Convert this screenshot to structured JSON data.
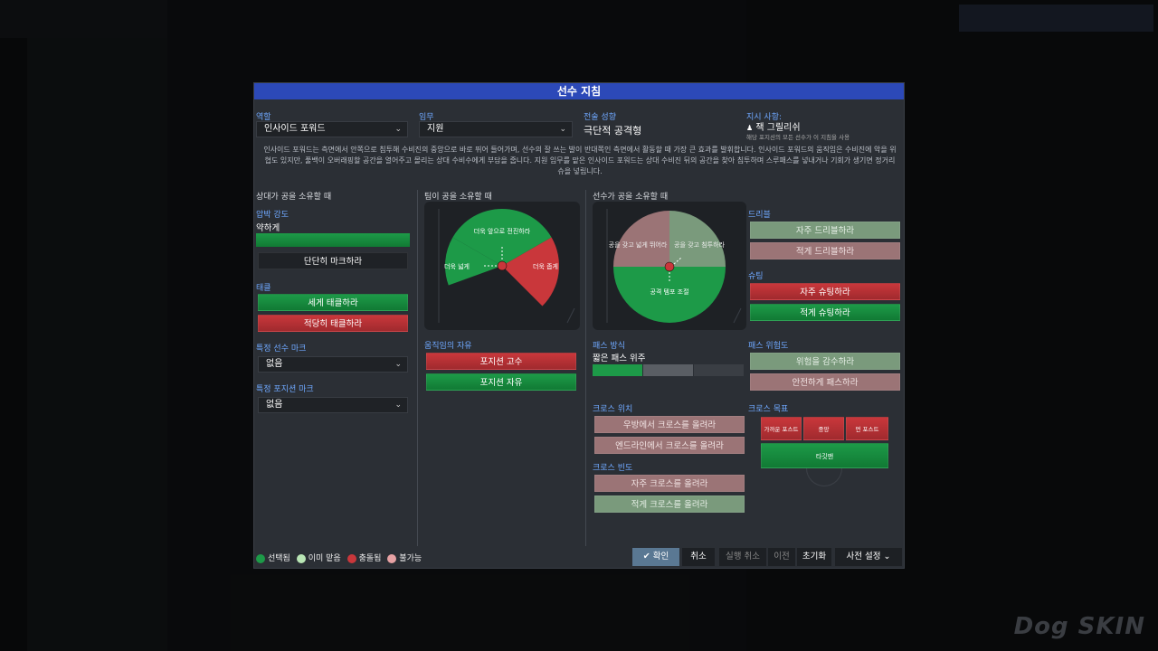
{
  "dialog": {
    "title": "선수 지침"
  },
  "role": {
    "label": "역할",
    "value": "인사이드 포워드"
  },
  "duty": {
    "label": "임무",
    "value": "지원"
  },
  "tactic": {
    "label": "전술 성향",
    "value": "극단적 공격형"
  },
  "instruction": {
    "label": "지시 사항:",
    "value": "잭 그릴리쉬",
    "note": "해당 포지션의 모든 선수가 이 지침을 사용"
  },
  "description": "인사이드 포워드는 측면에서 안쪽으로 침투해 수비진의 중앙으로 바로 뛰어 들어가며, 선수의 잘 쓰는 발이 반대쪽인 측면에서 활동할 때 가장 큰 효과를 발휘합니다. 인사이드 포워드의 움직임은 수비진에 악을 위협도 있지만, 풀백이 오버래핑할 공간을 열어주고 몰리는 상대 수비수에게 부담을 줍니다. 지원 임무를 맡은 인사이드 포워드는 상대 수비진 뒤의 공간을 찾아 침투하며 스루패스를 넣내거나 기회가 생기면 정거리 슈을 넣립니다.",
  "opp": {
    "section": "상대가 공을 소유할 때",
    "press_label": "압박 강도",
    "press_value": "약하게",
    "mark_button": "단단히 마크하라",
    "tackle_label": "태클",
    "tackle_hard": "세게 태클하라",
    "tackle_soft": "적당히 태클하라",
    "player_mark_label": "특정 선수 마크",
    "player_mark_value": "없음",
    "pos_mark_label": "특정 포지션 마크",
    "pos_mark_value": "없음"
  },
  "team": {
    "section": "팀이 공을 소유할 때",
    "zone_forward": "더욱 앞으로 전진하라",
    "zone_wide": "더욱 넓게",
    "zone_narrow": "더욱 좁게",
    "freedom_label": "움직임의 자유",
    "hold": "포지션 고수",
    "free": "포지션 자유"
  },
  "player": {
    "section": "선수가 공을 소유할 때",
    "q1": "공을 갖고 넓게 뛰어라",
    "q2": "공을 갖고 침투하라",
    "q3": "공격 템포 조절",
    "dribble_label": "드리블",
    "dribble_more": "자주 드리블하라",
    "dribble_less": "적게 드리블하라",
    "shoot_label": "슈팅",
    "shoot_more": "자주 슈팅하라",
    "shoot_less": "적게 슈팅하라",
    "pass_label": "패스 방식",
    "pass_value": "짧은 패스 위주",
    "risk_label": "패스 위험도",
    "risk_more": "위험을 감수하라",
    "risk_less": "안전하게 패스하라",
    "cross_from_label": "크로스 위치",
    "cross_from_1": "우방에서 크로스를 올려라",
    "cross_from_2": "엔드라인에서 크로스를 올려라",
    "cross_freq_label": "크로스 빈도",
    "cross_freq_more": "자주 크로스를 올려라",
    "cross_freq_less": "적게 크로스를 올려라",
    "cross_target_label": "크로스 목표",
    "target_near": "가까운 포스트",
    "target_center": "중앙",
    "target_far": "먼 포스트",
    "target_man": "타깃맨"
  },
  "legend": {
    "selected": "선택됨",
    "default": "이미 맡음",
    "conflict": "충돌됨",
    "unavailable": "불가능"
  },
  "footer": {
    "confirm": "확인",
    "cancel": "취소",
    "undo": "실행 취소",
    "prev": "이전",
    "reset": "초기화",
    "preset": "사전 설정"
  },
  "watermark": "Dog SKIN",
  "colors": {
    "green": "#1d9a48",
    "red": "#c9373b",
    "title": "#2c49b8",
    "label": "#6fa8ff"
  }
}
